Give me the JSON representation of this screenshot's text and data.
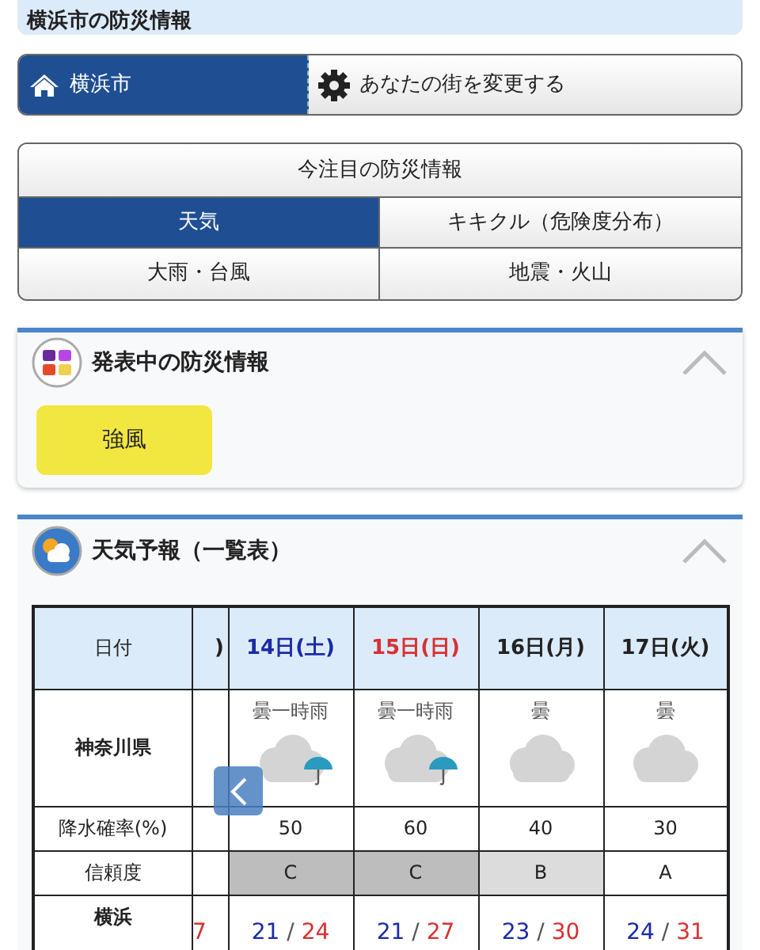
{
  "header": {
    "title": "横浜市の防災情報"
  },
  "location": {
    "city": "横浜市",
    "change_label": "あなたの街を変更する"
  },
  "topics": {
    "title": "今注目の防災情報",
    "tabs": [
      {
        "label": "天気",
        "selected": true
      },
      {
        "label": "キキクル（危険度分布）",
        "selected": false
      },
      {
        "label": "大雨・台風",
        "selected": false
      },
      {
        "label": "地震・火山",
        "selected": false
      }
    ]
  },
  "alerts": {
    "title": "発表中の防災情報",
    "expanded": true,
    "items": [
      {
        "label": "強風",
        "color": "#f2e640"
      }
    ]
  },
  "forecast": {
    "title": "天気予報（一覧表）",
    "expanded": true,
    "row_labels": {
      "date": "日付",
      "area": "神奈川県",
      "pop": "降水確率(%)",
      "reliability": "信頼度",
      "city": "横浜"
    },
    "days": [
      {
        "kind": "partial",
        "date": ")",
        "max": "7"
      },
      {
        "kind": "saturday",
        "date": "14日(土)",
        "weather": {
          "kind": "rain",
          "text": "曇一時雨"
        },
        "pop": "50",
        "reliability": {
          "kind": "low",
          "text": "C"
        },
        "min": "21",
        "separator": "/",
        "max": "24"
      },
      {
        "kind": "sunday",
        "date": "15日(日)",
        "weather": {
          "kind": "rain",
          "text": "曇一時雨"
        },
        "pop": "60",
        "reliability": {
          "kind": "low",
          "text": "C"
        },
        "min": "21",
        "separator": "/",
        "max": "27"
      },
      {
        "kind": "weekday",
        "date": "16日(月)",
        "weather": {
          "kind": "cloud",
          "text": "曇"
        },
        "pop": "40",
        "reliability": {
          "kind": "mid",
          "text": "B"
        },
        "min": "23",
        "separator": "/",
        "max": "30"
      },
      {
        "kind": "weekday",
        "date": "17日(火)",
        "weather": {
          "kind": "cloud",
          "text": "曇"
        },
        "pop": "30",
        "reliability": {
          "kind": "high",
          "text": "A"
        },
        "min": "24",
        "separator": "/",
        "max": "31"
      }
    ]
  }
}
